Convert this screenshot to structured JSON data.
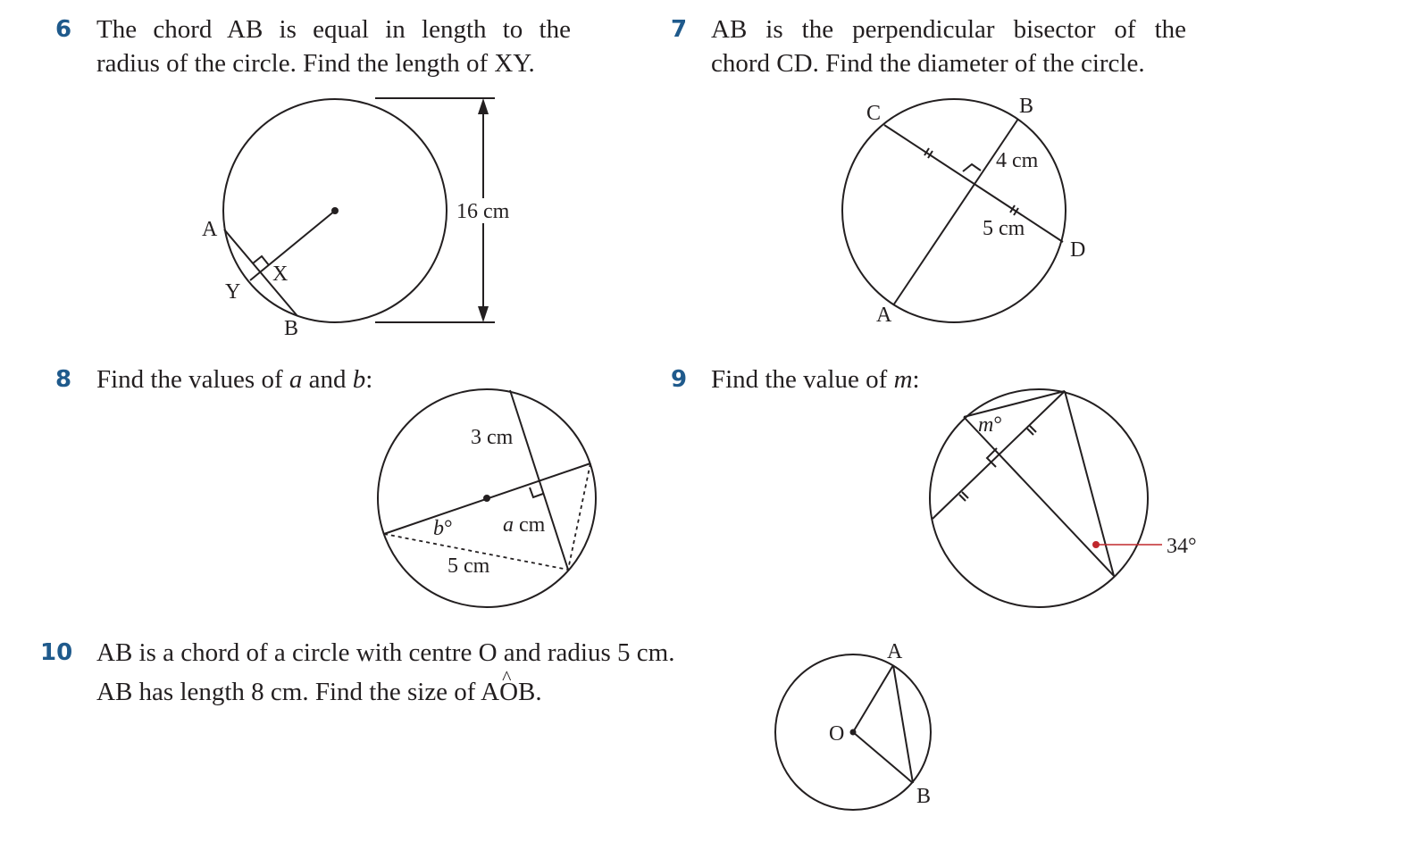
{
  "colors": {
    "question_number": "#1f5a8c",
    "ink": "#231f20",
    "annotation": "#c0282d"
  },
  "questions": [
    {
      "number": "6",
      "lines": [
        "The chord AB is equal in length to the",
        "radius of the circle. Find the length of XY."
      ],
      "figure": {
        "labels": {
          "A": "A",
          "B": "B",
          "X": "X",
          "Y": "Y",
          "diameter": "16 cm"
        }
      }
    },
    {
      "number": "7",
      "lines": [
        "AB is the perpendicular bisector of the",
        "chord CD. Find the diameter of the circle."
      ],
      "figure": {
        "labels": {
          "A": "A",
          "B": "B",
          "C": "C",
          "D": "D",
          "seg_b": "4 cm",
          "seg_d": "5 cm"
        }
      }
    },
    {
      "number": "8",
      "lines": [
        "Find the values of ",
        "a",
        " and ",
        "b",
        ":"
      ],
      "figure": {
        "labels": {
          "top": "3 cm",
          "a_var": "a",
          "a_unit": " cm",
          "b_var": "b",
          "b_deg": "°",
          "bottom": "5 cm"
        }
      }
    },
    {
      "number": "9",
      "lines": [
        "Find the value of ",
        "m",
        ":"
      ],
      "figure": {
        "labels": {
          "m_var": "m",
          "m_deg": "°",
          "angle": "34°"
        }
      }
    },
    {
      "number": "10",
      "lines": [
        "AB is a chord of a circle with centre O and radius 5 cm.",
        "AB has length 8 cm. Find the size of A",
        "O",
        "B."
      ],
      "figure": {
        "labels": {
          "A": "A",
          "B": "B",
          "O": "O"
        }
      }
    }
  ]
}
